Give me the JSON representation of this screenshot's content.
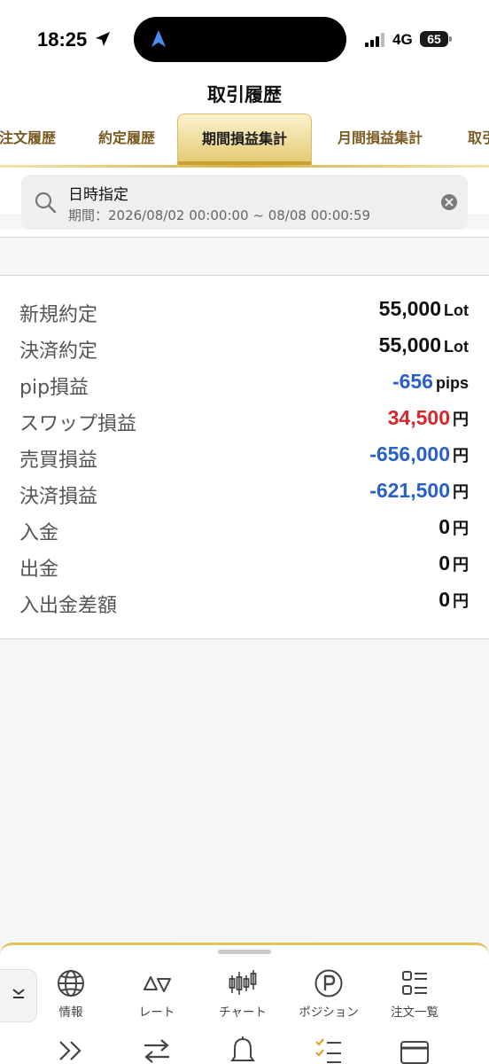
{
  "status_bar": {
    "time": "18:25",
    "network": "4G",
    "battery": "65"
  },
  "header": {
    "title": "取引履歴"
  },
  "tabs": [
    {
      "label": "注文履歴",
      "active": false
    },
    {
      "label": "約定履歴",
      "active": false
    },
    {
      "label": "期間損益集計",
      "active": true
    },
    {
      "label": "月間損益集計",
      "active": false
    },
    {
      "label": "取引",
      "active": false
    }
  ],
  "filter": {
    "title": "日時指定",
    "period": "期間：2026/08/02 00:00:00 ~ 08/08 00:00:59"
  },
  "summary": [
    {
      "label": "新規約定",
      "value": "55,000",
      "unit": "Lot",
      "tone": "normal"
    },
    {
      "label": "決済約定",
      "value": "55,000",
      "unit": "Lot",
      "tone": "normal"
    },
    {
      "label": "pip損益",
      "value": "-656",
      "unit": "pips",
      "tone": "negative"
    },
    {
      "label": "スワップ損益",
      "value": "34,500",
      "unit": "円",
      "tone": "positive"
    },
    {
      "label": "売買損益",
      "value": "-656,000",
      "unit": "円",
      "tone": "negative"
    },
    {
      "label": "決済損益",
      "value": "-621,500",
      "unit": "円",
      "tone": "negative"
    },
    {
      "label": "入金",
      "value": "0",
      "unit": "円",
      "tone": "normal"
    },
    {
      "label": "出金",
      "value": "0",
      "unit": "円",
      "tone": "normal"
    },
    {
      "label": "入出金差額",
      "value": "0",
      "unit": "円",
      "tone": "normal"
    }
  ],
  "bottom_nav": [
    {
      "label": "情報",
      "icon": "globe-icon"
    },
    {
      "label": "レート",
      "icon": "rate-triangles-icon"
    },
    {
      "label": "チャート",
      "icon": "candlestick-chart-icon"
    },
    {
      "label": "ポジション",
      "icon": "position-p-icon"
    },
    {
      "label": "注文一覧",
      "icon": "order-list-icon"
    }
  ],
  "bottom_nav_row2_icons": [
    "double-chevron-right-icon",
    "swap-arrows-icon",
    "bell-icon",
    "checklist-icon",
    "card-icon"
  ],
  "colors": {
    "accent_gold": "#d8b24a",
    "negative_blue": "#2a5fc9",
    "positive_red": "#d8262b",
    "tab_text": "#7a5a20"
  }
}
